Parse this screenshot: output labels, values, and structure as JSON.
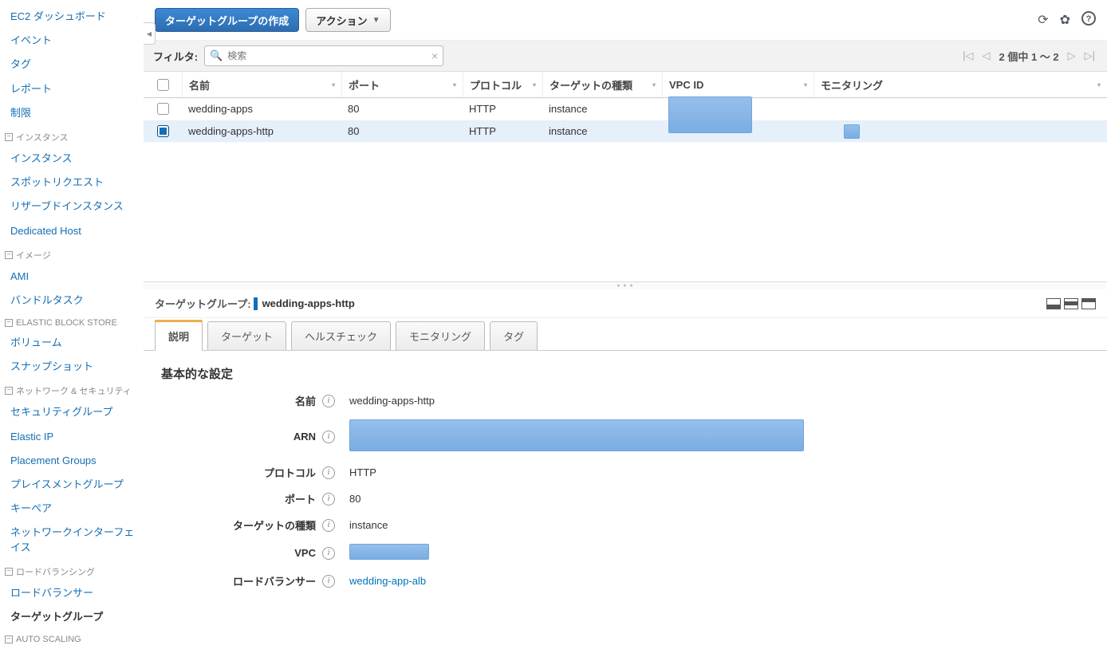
{
  "sidebar": {
    "items": [
      {
        "type": "link",
        "label": "EC2 ダッシュボード"
      },
      {
        "type": "link",
        "label": "イベント"
      },
      {
        "type": "link",
        "label": "タグ"
      },
      {
        "type": "link",
        "label": "レポート"
      },
      {
        "type": "link",
        "label": "制限"
      },
      {
        "type": "section",
        "label": "インスタンス"
      },
      {
        "type": "link",
        "label": "インスタンス"
      },
      {
        "type": "link",
        "label": "スポットリクエスト"
      },
      {
        "type": "link",
        "label": "リザーブドインスタンス"
      },
      {
        "type": "link",
        "label": "Dedicated Host"
      },
      {
        "type": "section",
        "label": "イメージ"
      },
      {
        "type": "link",
        "label": "AMI"
      },
      {
        "type": "link",
        "label": "バンドルタスク"
      },
      {
        "type": "section",
        "label": "ELASTIC BLOCK STORE"
      },
      {
        "type": "link",
        "label": "ボリューム"
      },
      {
        "type": "link",
        "label": "スナップショット"
      },
      {
        "type": "section",
        "label": "ネットワーク & セキュリティ"
      },
      {
        "type": "link",
        "label": "セキュリティグループ"
      },
      {
        "type": "link",
        "label": "Elastic IP"
      },
      {
        "type": "link",
        "label": "Placement Groups"
      },
      {
        "type": "link",
        "label": "プレイスメントグループ"
      },
      {
        "type": "link",
        "label": "キーペア"
      },
      {
        "type": "link",
        "label": "ネットワークインターフェイス"
      },
      {
        "type": "section",
        "label": "ロードバランシング"
      },
      {
        "type": "link",
        "label": "ロードバランサー"
      },
      {
        "type": "link",
        "label": "ターゲットグループ",
        "active": true
      },
      {
        "type": "section",
        "label": "AUTO SCALING"
      }
    ]
  },
  "toolbar": {
    "create_label": "ターゲットグループの作成",
    "actions_label": "アクション"
  },
  "filter": {
    "label": "フィルタ:",
    "placeholder": "検索"
  },
  "pager": {
    "text": "2 個中 1 ～ 2"
  },
  "columns": {
    "name": "名前",
    "port": "ポート",
    "protocol": "プロトコル",
    "type": "ターゲットの種類",
    "vpc": "VPC ID",
    "monitor": "モニタリング"
  },
  "rows": [
    {
      "selected": false,
      "name": "wedding-apps",
      "port": "80",
      "protocol": "HTTP",
      "type": "instance"
    },
    {
      "selected": true,
      "name": "wedding-apps-http",
      "port": "80",
      "protocol": "HTTP",
      "type": "instance"
    }
  ],
  "detail": {
    "title_prefix": "ターゲットグループ:",
    "selected_name": "wedding-apps-http",
    "tabs": [
      "説明",
      "ターゲット",
      "ヘルスチェック",
      "モニタリング",
      "タグ"
    ],
    "section_heading": "基本的な設定",
    "fields": {
      "name_lbl": "名前",
      "name_val": "wedding-apps-http",
      "arn_lbl": "ARN",
      "proto_lbl": "プロトコル",
      "proto_val": "HTTP",
      "port_lbl": "ポート",
      "port_val": "80",
      "type_lbl": "ターゲットの種類",
      "type_val": "instance",
      "vpc_lbl": "VPC",
      "lb_lbl": "ロードバランサー",
      "lb_val": "wedding-app-alb"
    }
  }
}
